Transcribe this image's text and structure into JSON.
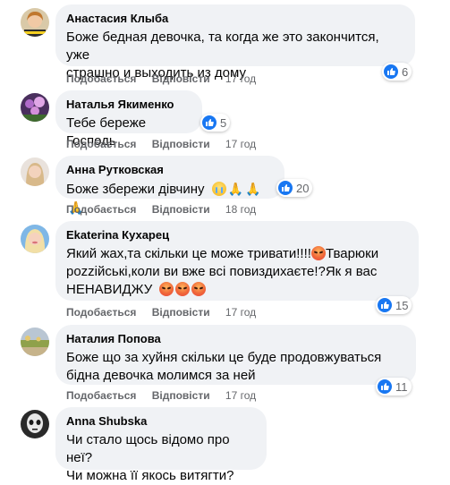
{
  "comments": [
    {
      "author": "Анастасия Клыба",
      "text": "Боже бедная девочка, та когда же это закончится, уже страшно и выходить из дому",
      "line1": "Боже бедная девочка, та когда же это закончится, уже",
      "line2": "страшно и выходить из дому",
      "like": "Подобається",
      "reply": "Відповісти",
      "time": "17 год",
      "reactions": "6"
    },
    {
      "author": "Наталья Якименко",
      "line1": "Тебе береже Господь",
      "like": "Подобається",
      "reply": "Відповісти",
      "time": "17 год",
      "reactions": "5"
    },
    {
      "author": "Анна Рутковская",
      "line1": "Боже збережи дівчину",
      "like": "Подобається",
      "reply": "Відповісти",
      "time": "18 год",
      "reactions": "20"
    },
    {
      "author": "Ekaterina Кухарец",
      "line1": "Який жах,та скільки це може тривати!!!!",
      "line1b": "Тварюки",
      "line2": "pozziйські,коли ви вже всі повиздихаєте!?Як я вас",
      "line3": "НЕНАВИДЖУ",
      "like": "Подобається",
      "reply": "Відповісти",
      "time": "17 год",
      "reactions": "15"
    },
    {
      "author": "Наталия Попова",
      "line1": "Боже що за хуйня скільки це буде продовжуваться",
      "line2": "бідна девочка молимся за ней",
      "like": "Подобається",
      "reply": "Відповісти",
      "time": "17 год",
      "reactions": "11"
    },
    {
      "author": "Anna Shubska",
      "line1": "Чи стало щось відомо про неї?",
      "line2": "Чи можна її якось витягти?"
    }
  ],
  "colors": {
    "bubble": "#f0f2f5",
    "like_blue": "#1877f2",
    "meta_gray": "#65676b"
  }
}
